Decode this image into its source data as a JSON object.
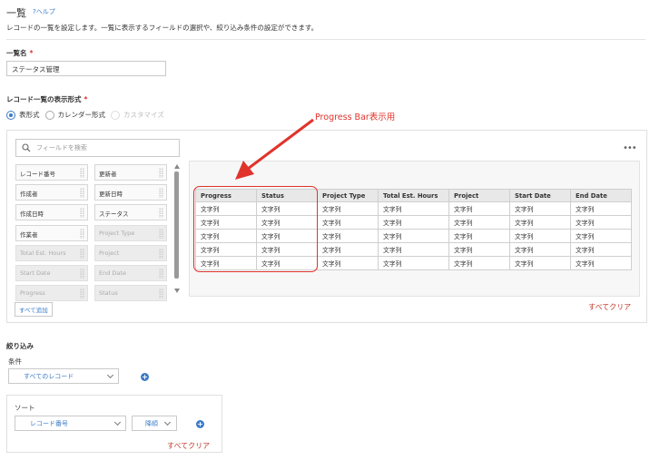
{
  "page": {
    "title": "一覧",
    "help": "?ヘルプ",
    "description": "レコードの一覧を設定します。一覧に表示するフィールドの選択や、絞り込み条件の設定ができます。"
  },
  "name_section": {
    "label": "一覧名",
    "required_mark": "*",
    "value": "ステータス管理"
  },
  "format_section": {
    "label": "レコード一覧の表示形式",
    "required_mark": "*",
    "options": [
      "表形式",
      "カレンダー形式",
      "カスタマイズ"
    ],
    "selected": "表形式"
  },
  "field_picker": {
    "search_placeholder": "フィールドを検索",
    "fields_col1": [
      "レコード番号",
      "作成者",
      "作成日時",
      "作業者",
      "Total Est. Hours",
      "Start Date",
      "Progress"
    ],
    "fields_col2": [
      "更新者",
      "更新日時",
      "ステータス",
      "Project Type",
      "Project",
      "End Date",
      "Status"
    ],
    "add_all": "すべて追加"
  },
  "preview": {
    "more": "•••",
    "columns": [
      "Progress",
      "Status",
      "Project Type",
      "Total Est. Hours",
      "Project",
      "Start Date",
      "End Date"
    ],
    "cell_text": "文字列",
    "row_count": 5,
    "clear_all": "すべてクリア"
  },
  "annotation": {
    "text": "Progress Bar表示用",
    "color": "#e0332b"
  },
  "filter_section": {
    "label": "絞り込み",
    "condition_label": "条件",
    "condition_value": "すべてのレコード"
  },
  "sort_section": {
    "label": "ソート",
    "field_value": "レコード番号",
    "order_value": "降順",
    "clear_all": "すべてクリア"
  },
  "colors": {
    "accent": "#3b7bc8",
    "danger": "#e0332b"
  }
}
